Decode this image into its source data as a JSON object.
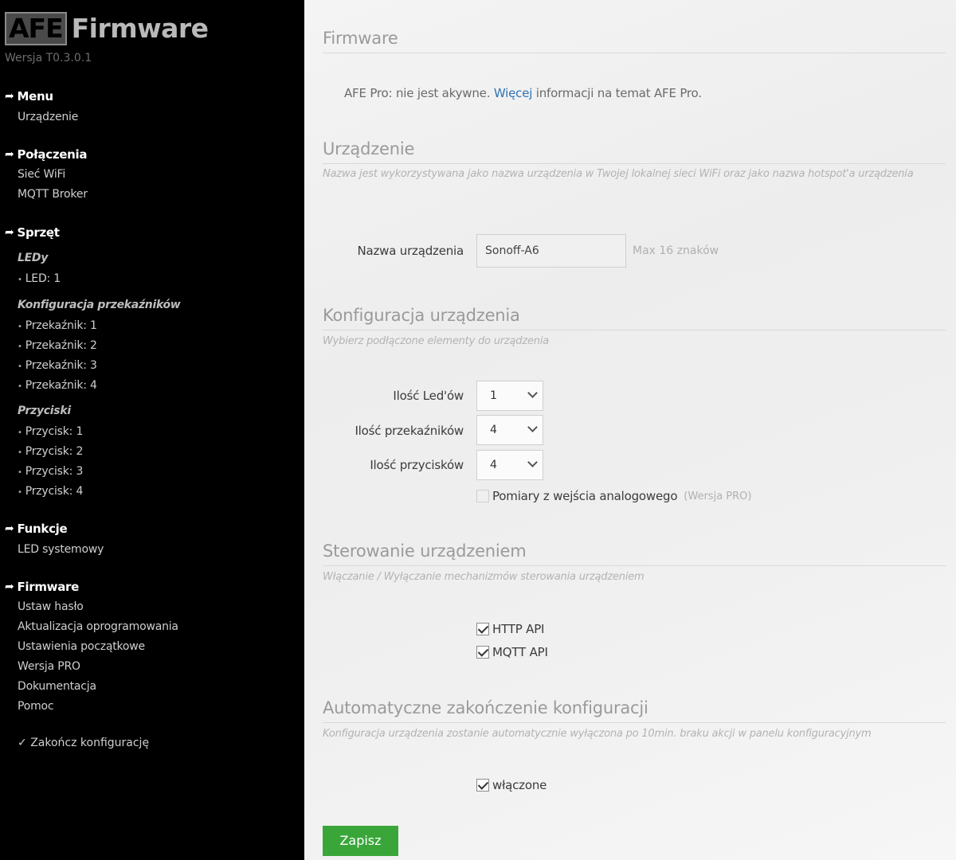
{
  "sidebar": {
    "logo_box": "AFE",
    "logo_text": "Firmware",
    "version": "Wersja T0.3.0.1",
    "menu": {
      "title": "Menu",
      "items": [
        "Urządzenie"
      ]
    },
    "connections": {
      "title": "Połączenia",
      "items": [
        "Sieć WiFi",
        "MQTT Broker"
      ]
    },
    "hardware": {
      "title": "Sprzęt",
      "leds_head": "LEDy",
      "leds": [
        "LED: 1"
      ],
      "relays_head": "Konfiguracja przekaźników",
      "relays": [
        "Przekaźnik: 1",
        "Przekaźnik: 2",
        "Przekaźnik: 3",
        "Przekaźnik: 4"
      ],
      "buttons_head": "Przyciski",
      "buttons": [
        "Przycisk: 1",
        "Przycisk: 2",
        "Przycisk: 3",
        "Przycisk: 4"
      ]
    },
    "functions": {
      "title": "Funkcje",
      "items": [
        "LED systemowy"
      ]
    },
    "firmware": {
      "title": "Firmware",
      "items": [
        "Ustaw hasło",
        "Aktualizacja oprogramowania",
        "Ustawienia początkowe",
        "Wersja PRO",
        "Dokumentacja",
        "Pomoc"
      ]
    },
    "finish": "Zakończ konfigurację",
    "finish_mark": "✓",
    "arrow_icon": "➦"
  },
  "main": {
    "firmware": {
      "title": "Firmware",
      "info_before": "AFE Pro: nie jest akywne. ",
      "info_link": "Więcej",
      "info_after": " informacji na temat AFE Pro."
    },
    "device": {
      "title": "Urządzenie",
      "desc": "Nazwa jest wykorzystywana jako nazwa urządzenia w Twojej lokalnej sieci WiFi oraz jako nazwa hotspot'a urządzenia",
      "name_label": "Nazwa urządzenia",
      "name_value": "Sonoff-A6",
      "name_hint": "Max 16 znaków"
    },
    "config": {
      "title": "Konfiguracja urządzenia",
      "desc": "Wybierz podłączone elementy do urządzenia",
      "leds_label": "Ilość Led'ów",
      "leds_value": "1",
      "relays_label": "Ilość przekaźników",
      "relays_value": "4",
      "buttons_label": "Ilość przycisków",
      "buttons_value": "4",
      "analog_label": "Pomiary z wejścia analogowego",
      "analog_note": "(Wersja PRO)"
    },
    "control": {
      "title": "Sterowanie urządzeniem",
      "desc": "Włączanie / Wyłączanie mechanizmów sterowania urządzeniem",
      "http_label": "HTTP API",
      "mqtt_label": "MQTT API"
    },
    "auto_finish": {
      "title": "Automatyczne zakończenie konfiguracji",
      "desc": "Konfiguracja urządzenia zostanie automatycznie wyłączona po 10min. braku akcji w panelu konfiguracyjnym",
      "enabled_label": "włączone"
    },
    "save_label": "Zapisz",
    "accent_color": "#3aa63a",
    "link_color": "#2f73b8"
  }
}
